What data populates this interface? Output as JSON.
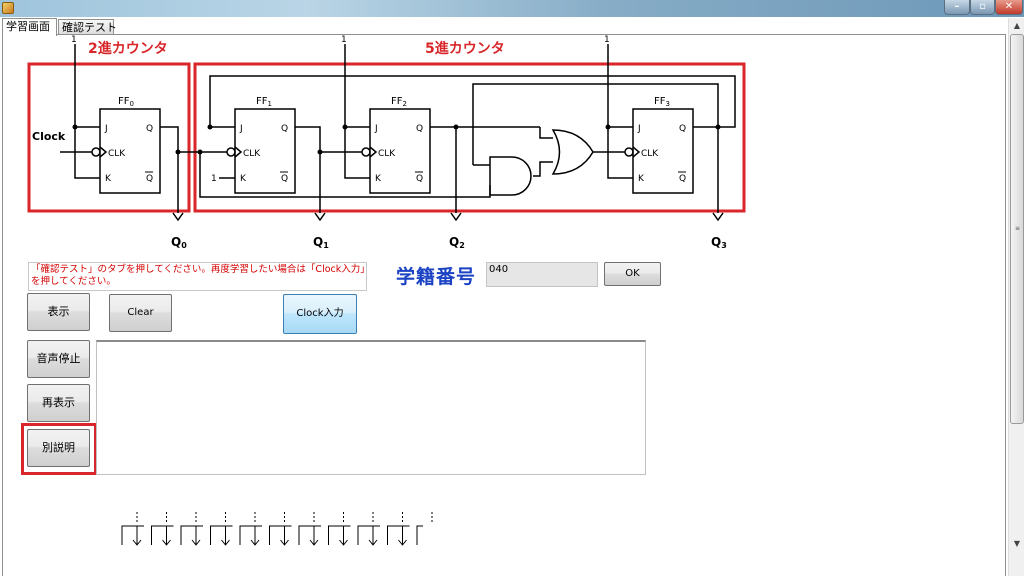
{
  "window": {
    "controls": {
      "minimize": "–",
      "maximize": "▫",
      "close": "✕"
    }
  },
  "tabs": [
    {
      "label": "学習画面"
    },
    {
      "label": "確認テスト"
    }
  ],
  "circuit": {
    "counter2_label": "2進カウンタ",
    "counter5_label": "5進カウンタ",
    "clock_label": "Clock",
    "high_input": "1",
    "ff_names": [
      "FF",
      "FF",
      "FF",
      "FF"
    ],
    "ff_subscripts": [
      "0",
      "1",
      "2",
      "3"
    ],
    "pin_j": "J",
    "pin_k": "K",
    "pin_q": "Q",
    "pin_qbar": "Q",
    "pin_clk": "CLK",
    "outputs": [
      {
        "name": "Q",
        "sub": "0"
      },
      {
        "name": "Q",
        "sub": "1"
      },
      {
        "name": "Q",
        "sub": "2"
      },
      {
        "name": "Q",
        "sub": "3"
      }
    ],
    "accent_color": "#d9262a"
  },
  "instruction": {
    "text": "「確認テスト」のタブを押してください。再度学習したい場合は「Clock入力」を押してください。"
  },
  "student": {
    "label": "学籍番号",
    "value": "040",
    "ok_label": "OK"
  },
  "buttons": {
    "show": "表示",
    "clear": "Clear",
    "clock_input": "Clock入力",
    "audio_stop": "音声停止",
    "redisplay": "再表示",
    "extra_explain": "別説明"
  },
  "message_area": {
    "text": ""
  },
  "scrollbar": {
    "up": "▲",
    "down": "▼",
    "grip": "≡"
  }
}
